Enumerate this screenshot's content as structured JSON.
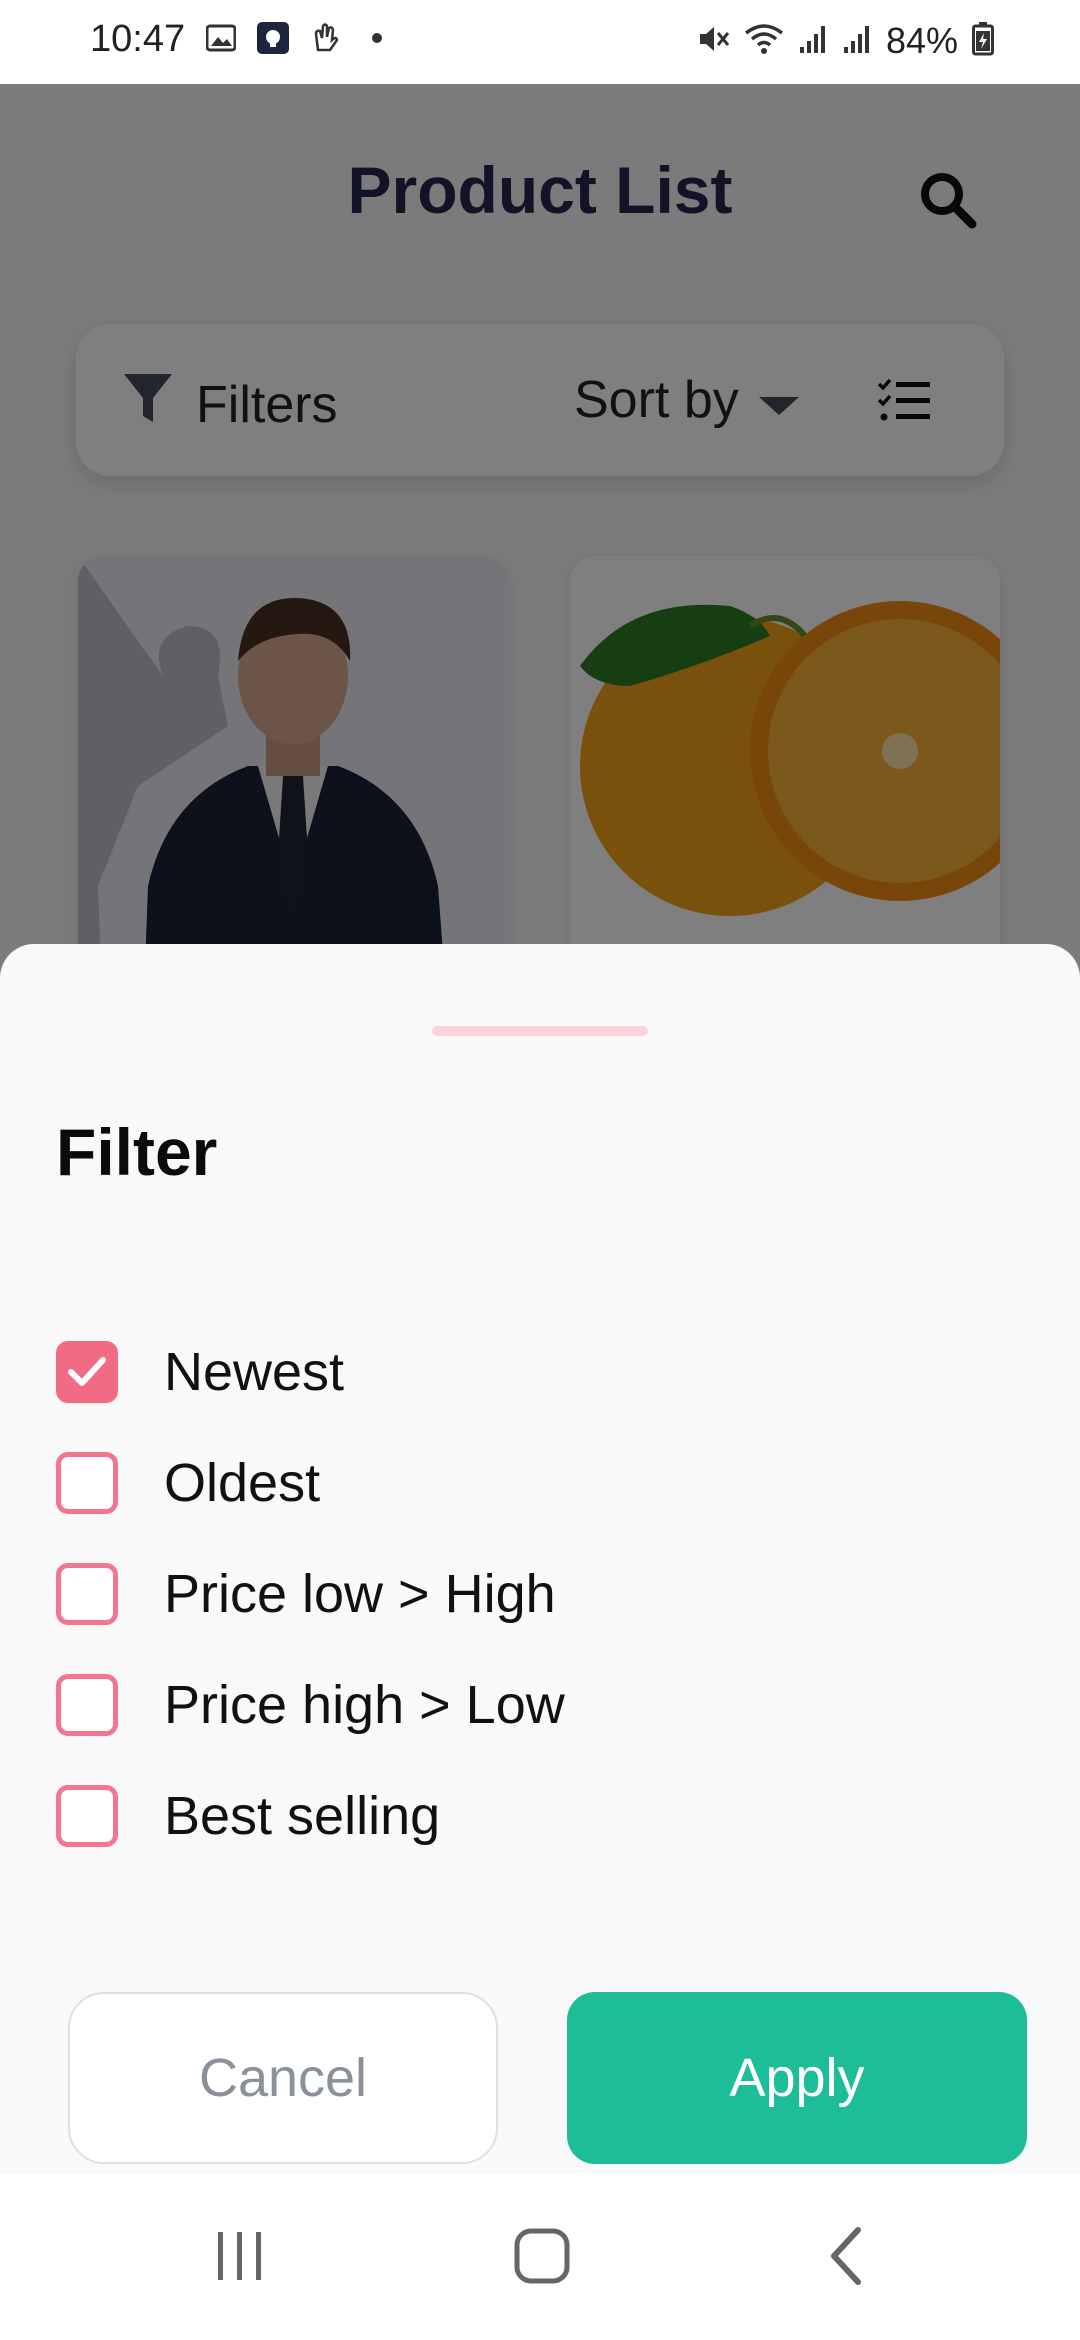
{
  "status_bar": {
    "time": "10:47",
    "battery": "84%",
    "icons": [
      "gallery-icon",
      "app-icon",
      "gesture-icon",
      "dot-icon",
      "mute-icon",
      "wifi-icon",
      "signal-icon",
      "signal-icon",
      "battery-icon"
    ]
  },
  "app": {
    "title": "Product List",
    "filter_label": "Filters",
    "sort_label": "Sort by"
  },
  "sheet": {
    "title": "Filter",
    "options": [
      {
        "label": "Newest",
        "checked": true
      },
      {
        "label": "Oldest",
        "checked": false
      },
      {
        "label": "Price low > High",
        "checked": false
      },
      {
        "label": "Price high > Low",
        "checked": false
      },
      {
        "label": "Best selling",
        "checked": false
      }
    ],
    "cancel_label": "Cancel",
    "apply_label": "Apply"
  },
  "colors": {
    "accent": "#f26b85",
    "apply": "#1dbd98",
    "title": "#262650"
  }
}
